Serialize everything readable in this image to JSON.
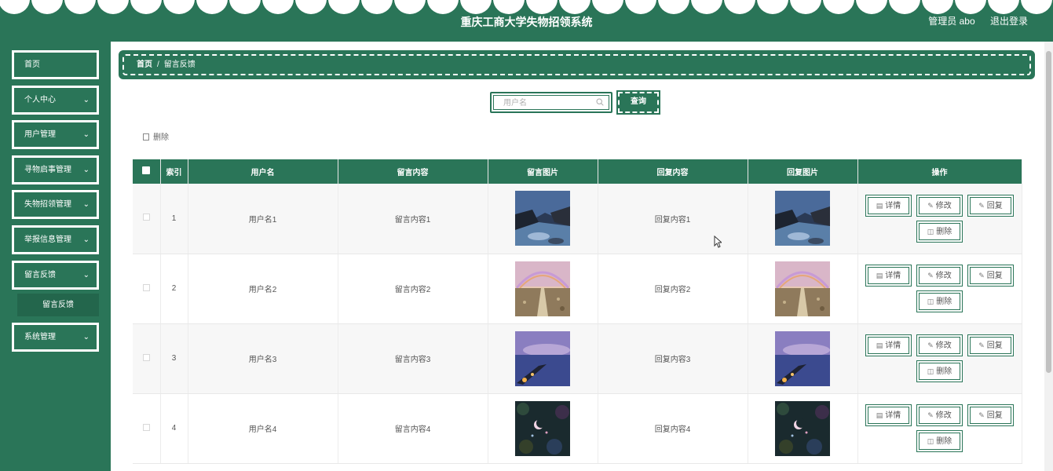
{
  "header": {
    "title": "重庆工商大学失物招领系统",
    "user_label": "管理员 abo",
    "logout_label": "退出登录"
  },
  "sidebar": {
    "items": [
      {
        "label": "首页",
        "has_chevron": false
      },
      {
        "label": "个人中心",
        "has_chevron": true
      },
      {
        "label": "用户管理",
        "has_chevron": true
      },
      {
        "label": "寻物启事管理",
        "has_chevron": true
      },
      {
        "label": "失物招领管理",
        "has_chevron": true
      },
      {
        "label": "举报信息管理",
        "has_chevron": true
      },
      {
        "label": "留言反馈",
        "has_chevron": true
      },
      {
        "label": "系统管理",
        "has_chevron": true
      }
    ],
    "submenu": {
      "label": "留言反馈"
    }
  },
  "breadcrumb": {
    "home": "首页",
    "separator": "/",
    "current": "留言反馈"
  },
  "search": {
    "placeholder": "用户名",
    "value": "",
    "button_label": "查询"
  },
  "toolbar": {
    "delete_label": "删除"
  },
  "table": {
    "headers": [
      "索引",
      "用户名",
      "留言内容",
      "留言图片",
      "回复内容",
      "回复图片",
      "操作"
    ],
    "rows": [
      {
        "index": "1",
        "username": "用户名1",
        "content": "留言内容1",
        "reply": "回复内容1",
        "image": "river-icon"
      },
      {
        "index": "2",
        "username": "用户名2",
        "content": "留言内容2",
        "reply": "回复内容2",
        "image": "rainbow-icon"
      },
      {
        "index": "3",
        "username": "用户名3",
        "content": "留言内容3",
        "reply": "回复内容3",
        "image": "pier-icon"
      },
      {
        "index": "4",
        "username": "用户名4",
        "content": "留言内容4",
        "reply": "回复内容4",
        "image": "moon-icon"
      }
    ],
    "actions": {
      "detail": "详情",
      "edit": "修改",
      "reply": "回复",
      "delete": "删除"
    }
  },
  "colors": {
    "primary": "#2a7558",
    "sub_menu": "#23664c"
  }
}
